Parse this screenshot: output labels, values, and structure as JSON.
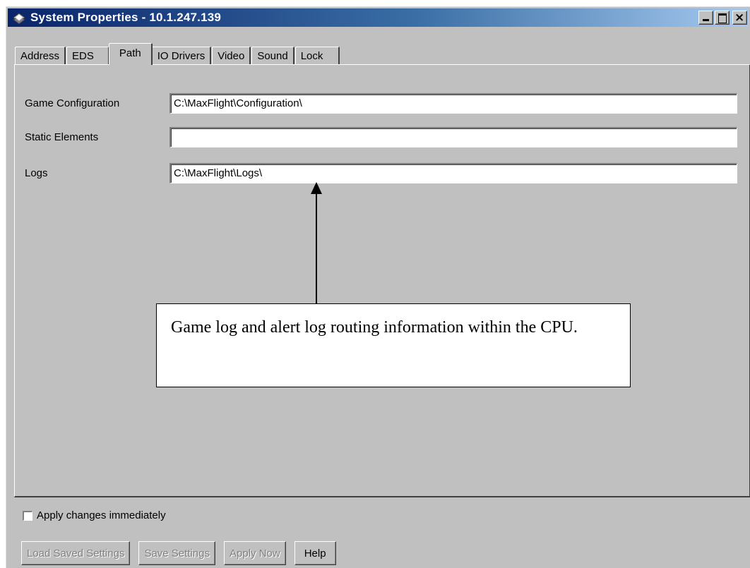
{
  "window": {
    "title": "System Properties - 10.1.247.139"
  },
  "tabs": [
    {
      "label": "Address",
      "active": false
    },
    {
      "label": "EDS",
      "active": false
    },
    {
      "label": "Path",
      "active": true
    },
    {
      "label": "IO Drivers",
      "active": false
    },
    {
      "label": "Video",
      "active": false
    },
    {
      "label": "Sound",
      "active": false
    },
    {
      "label": "Lock",
      "active": false
    }
  ],
  "fields": [
    {
      "label": "Game Configuration",
      "value": "C:\\MaxFlight\\Configuration\\"
    },
    {
      "label": "Static Elements",
      "value": ""
    },
    {
      "label": "Logs",
      "value": "C:\\MaxFlight\\Logs\\"
    }
  ],
  "callout": {
    "text": "Game log and alert log routing information within the CPU."
  },
  "options": {
    "apply_immediately_label": "Apply changes immediately",
    "apply_immediately_checked": false
  },
  "buttons": {
    "load_saved": "Load Saved Settings",
    "save_settings": "Save Settings",
    "apply_now": "Apply Now",
    "help": "Help"
  }
}
